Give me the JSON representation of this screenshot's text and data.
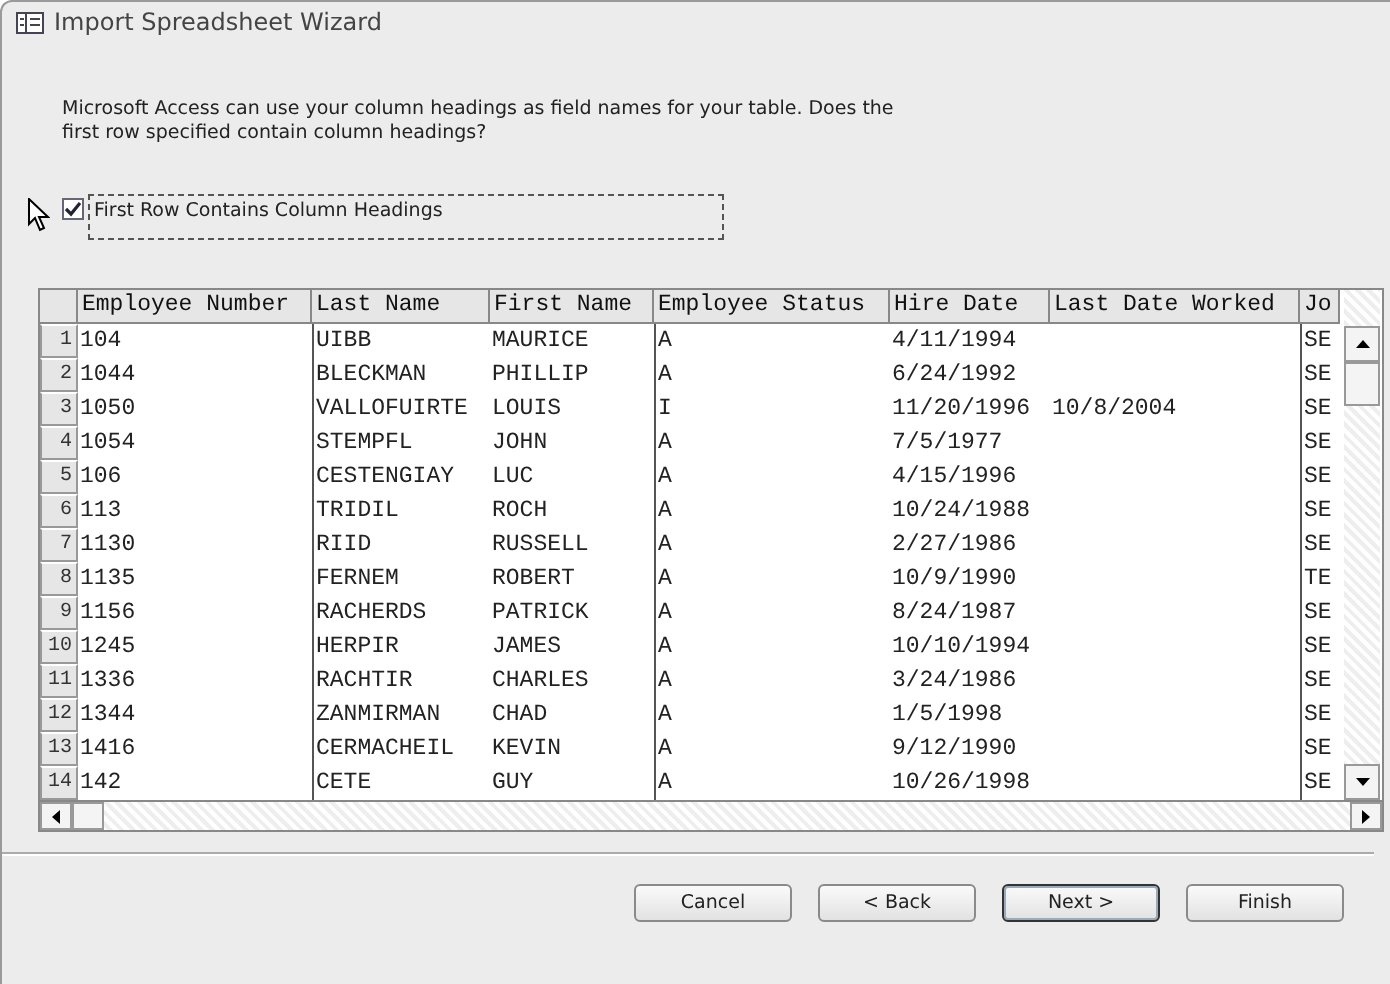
{
  "window": {
    "title": "Import Spreadsheet Wizard"
  },
  "instructions": "Microsoft Access can use your column headings as field names for your table. Does the first row specified contain column headings?",
  "option": {
    "label": "First Row Contains Column Headings",
    "checked": true
  },
  "grid": {
    "columns": [
      "Employee Number",
      "Last Name",
      "First Name",
      "Employee Status",
      "Hire Date",
      "Last Date Worked",
      "Jo"
    ],
    "rows": [
      {
        "number": "1",
        "cells": [
          "104",
          "UIBB",
          "MAURICE",
          "A",
          "4/11/1994",
          "",
          "SE"
        ]
      },
      {
        "number": "2",
        "cells": [
          "1044",
          "BLECKMAN",
          "PHILLIP",
          "A",
          "6/24/1992",
          "",
          "SE"
        ]
      },
      {
        "number": "3",
        "cells": [
          "1050",
          "VALLOFUIRTE",
          "LOUIS",
          "I",
          "11/20/1996",
          "10/8/2004",
          "SE"
        ]
      },
      {
        "number": "4",
        "cells": [
          "1054",
          "STEMPFL",
          "JOHN",
          "A",
          "7/5/1977",
          "",
          "SE"
        ]
      },
      {
        "number": "5",
        "cells": [
          "106",
          "CESTENGIAY",
          "LUC",
          "A",
          "4/15/1996",
          "",
          "SE"
        ]
      },
      {
        "number": "6",
        "cells": [
          "113",
          "TRIDIL",
          "ROCH",
          "A",
          "10/24/1988",
          "",
          "SE"
        ]
      },
      {
        "number": "7",
        "cells": [
          "1130",
          "RIID",
          "RUSSELL",
          "A",
          "2/27/1986",
          "",
          "SE"
        ]
      },
      {
        "number": "8",
        "cells": [
          "1135",
          "FERNEM",
          "ROBERT",
          "A",
          "10/9/1990",
          "",
          "TE"
        ]
      },
      {
        "number": "9",
        "cells": [
          "1156",
          "RACHERDS",
          "PATRICK",
          "A",
          "8/24/1987",
          "",
          "SE"
        ]
      },
      {
        "number": "10",
        "cells": [
          "1245",
          "HERPIR",
          "JAMES",
          "A",
          "10/10/1994",
          "",
          "SE"
        ]
      },
      {
        "number": "11",
        "cells": [
          "1336",
          "RACHTIR",
          "CHARLES",
          "A",
          "3/24/1986",
          "",
          "SE"
        ]
      },
      {
        "number": "12",
        "cells": [
          "1344",
          "ZANMIRMAN",
          "CHAD",
          "A",
          "1/5/1998",
          "",
          "SE"
        ]
      },
      {
        "number": "13",
        "cells": [
          "1416",
          "CERMACHEIL",
          "KEVIN",
          "A",
          "9/12/1990",
          "",
          "SE"
        ]
      },
      {
        "number": "14",
        "cells": [
          "142",
          "CETE",
          "GUY",
          "A",
          "10/26/1998",
          "",
          "SE"
        ]
      }
    ]
  },
  "buttons": [
    {
      "label": "Cancel",
      "default": false
    },
    {
      "label": "< Back",
      "default": false
    },
    {
      "label": "Next >",
      "default": true
    },
    {
      "label": "Finish",
      "default": false
    }
  ]
}
